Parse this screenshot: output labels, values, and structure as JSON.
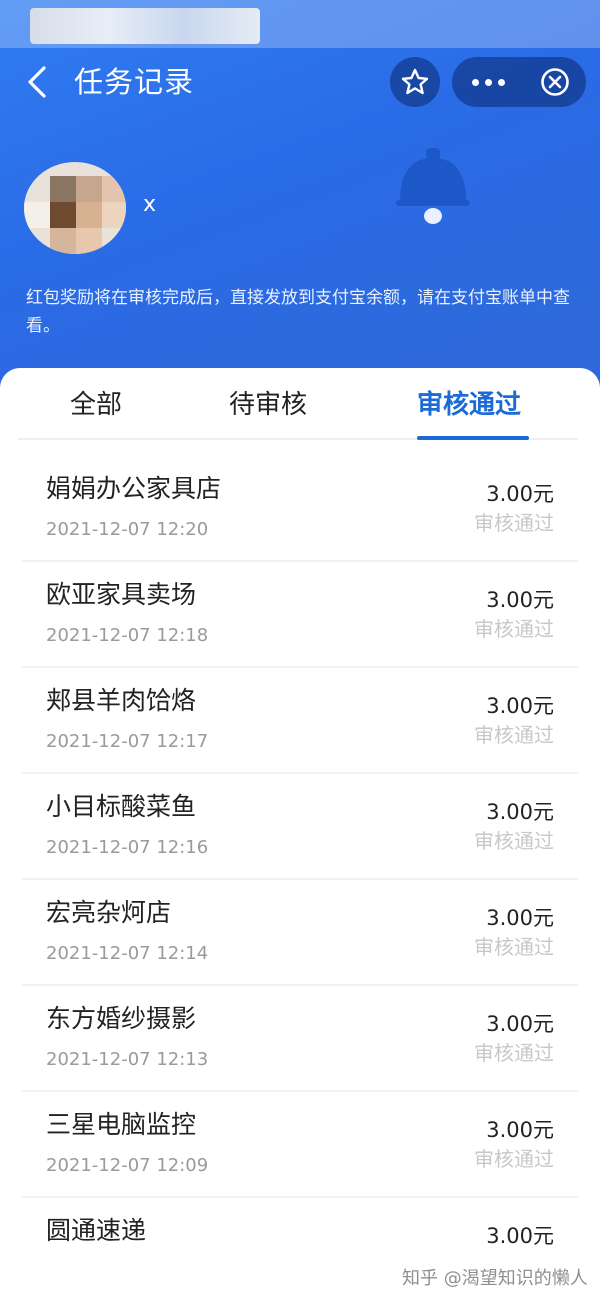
{
  "header": {
    "title": "任务记录",
    "back_icon": "chevron-left-icon",
    "star_icon": "star-icon",
    "more_icon": "more-dots-icon",
    "close_icon": "close-circle-icon"
  },
  "user": {
    "name": "x"
  },
  "notice": "红包奖励将在审核完成后，直接发放到支付宝余额，请在支付宝账单中查看。",
  "tabs": [
    {
      "label": "全部",
      "active": false
    },
    {
      "label": "待审核",
      "active": false
    },
    {
      "label": "审核通过",
      "active": true
    }
  ],
  "colors": {
    "brand_blue": "#2a6be6",
    "active_tab": "#1a6ad8",
    "status_gray": "#c8c8c8"
  },
  "records": [
    {
      "shop": "娟娟办公家具店",
      "time": "2021-12-07 12:20",
      "amount": "3.00元",
      "status": "审核通过"
    },
    {
      "shop": "欧亚家具卖场",
      "time": "2021-12-07 12:18",
      "amount": "3.00元",
      "status": "审核通过"
    },
    {
      "shop": "郏县羊肉饸烙",
      "time": "2021-12-07 12:17",
      "amount": "3.00元",
      "status": "审核通过"
    },
    {
      "shop": "小目标酸菜鱼",
      "time": "2021-12-07 12:16",
      "amount": "3.00元",
      "status": "审核通过"
    },
    {
      "shop": "宏亮杂炣店",
      "time": "2021-12-07 12:14",
      "amount": "3.00元",
      "status": "审核通过"
    },
    {
      "shop": "东方婚纱摄影",
      "time": "2021-12-07 12:13",
      "amount": "3.00元",
      "status": "审核通过"
    },
    {
      "shop": "三星电脑监控",
      "time": "2021-12-07 12:09",
      "amount": "3.00元",
      "status": "审核通过"
    },
    {
      "shop": "圆通速递",
      "time": "",
      "amount": "3.00元",
      "status": ""
    }
  ],
  "watermark": "知乎 @渴望知识的懒人"
}
